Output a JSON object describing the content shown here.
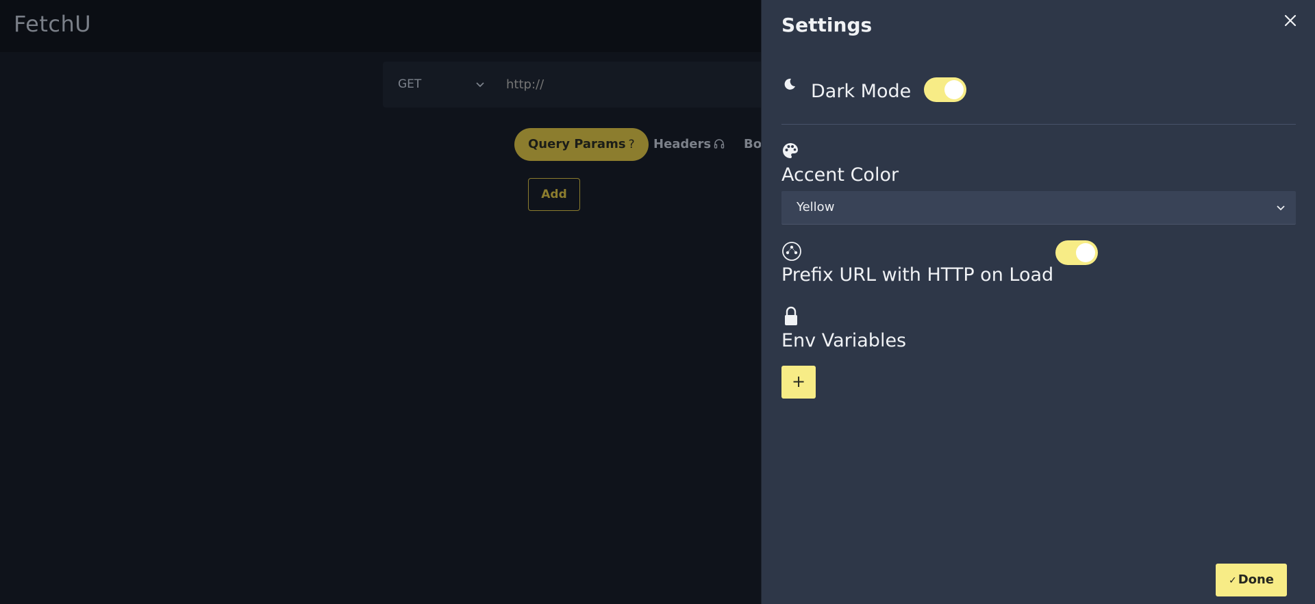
{
  "app": {
    "title": "FetchU"
  },
  "request": {
    "method": "GET",
    "url_placeholder": "http://"
  },
  "tabs": [
    {
      "label": "Query Params",
      "icon": "?",
      "icon_name": "question-icon",
      "active": true
    },
    {
      "label": "Headers",
      "icon": "🎧",
      "icon_name": "headphones-icon",
      "active": false
    },
    {
      "label": "Bo",
      "active": false
    }
  ],
  "params": {
    "add_label": "Add"
  },
  "settings": {
    "title": "Settings",
    "dark_mode": {
      "label": "Dark Mode",
      "icon": "moon-icon",
      "enabled": true
    },
    "accent_color": {
      "label": "Accent Color",
      "icon": "palette-icon",
      "value": "Yellow"
    },
    "prefix_url": {
      "label": "Prefix URL with HTTP on Load",
      "icon": "network-icon",
      "enabled": true
    },
    "env_variables": {
      "label": "Env Variables",
      "icon": "lock-icon",
      "add_label": "+"
    },
    "done_label": "Done"
  },
  "colors": {
    "accent": "#f7ec86",
    "accent_dim": "#8c7d2e",
    "drawer_bg": "#2e3748",
    "app_bg": "#0f131b"
  }
}
